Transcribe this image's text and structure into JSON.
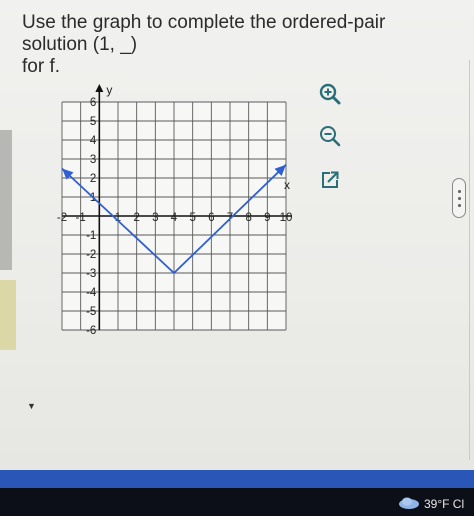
{
  "question": {
    "line1": "Use the graph to complete the ordered-pair solution (1, _)",
    "line2": "for f."
  },
  "toolbar": {
    "zoom_in_icon": "zoom-in-magnifier",
    "zoom_out_icon": "zoom-out-magnifier",
    "popout_icon": "open-in-new-window",
    "icon_color": "#2a6e78"
  },
  "chart_data": {
    "type": "line",
    "xlabel": "x",
    "ylabel": "y",
    "xlim": [
      -2,
      10
    ],
    "ylim": [
      -6,
      6
    ],
    "grid": true,
    "x_tick_labels": [
      "-2",
      "-1",
      "1",
      "2",
      "3",
      "4",
      "5",
      "6",
      "7",
      "8",
      "9",
      "10"
    ],
    "y_tick_labels": [
      "6",
      "5",
      "4",
      "3",
      "2",
      "1",
      "-1",
      "-2",
      "-3",
      "-4",
      "-5",
      "-6"
    ],
    "series": [
      {
        "color": "#2f5fd0",
        "arrows_at_both_ends": true,
        "points": [
          [
            -2,
            2.5
          ],
          [
            4,
            -3
          ],
          [
            10,
            2.7
          ]
        ]
      }
    ]
  },
  "taskbar": {
    "weather_text": "39°F Cl",
    "band_color": "#2a56b8"
  }
}
